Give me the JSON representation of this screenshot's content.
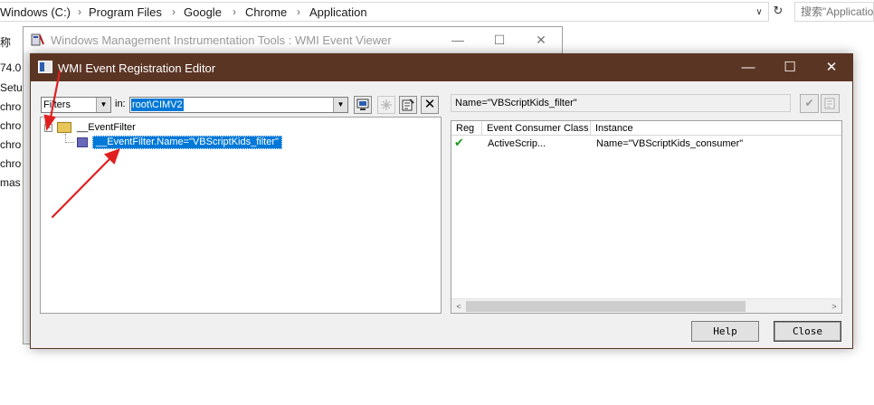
{
  "explorer": {
    "breadcrumbs": [
      "Windows (C:)",
      "Program Files",
      "Google",
      "Chrome",
      "Application"
    ],
    "search_placeholder": "搜索\"Application\"",
    "file_list": [
      "称",
      "74.0",
      "Setu",
      "chro",
      "chro",
      "chro",
      "chro",
      "mas"
    ]
  },
  "viewer": {
    "title": "Windows Management Instrumentation Tools : WMI Event Viewer"
  },
  "editor": {
    "title": "WMI Event Registration Editor",
    "filter_type": "Filters",
    "in_label": "in:",
    "namespace": "root\\CIMV2",
    "tree": {
      "root_label": "__EventFilter",
      "expander": "−",
      "child_label": "__EventFilter.Name=\"VBScriptKids_filter\""
    },
    "selected_path": "Name=\"VBScriptKids_filter\"",
    "grid": {
      "columns": [
        "Reg",
        "Event Consumer Class",
        "Instance"
      ],
      "rows": [
        {
          "consumer_class": "ActiveScrip...",
          "instance": "Name=\"VBScriptKids_consumer\""
        }
      ]
    },
    "buttons": {
      "help": "Help",
      "close": "Close"
    }
  },
  "colors": {
    "editor_titlebar": "#5b3524",
    "selection": "#0078d7",
    "annotation_arrow": "#e02020"
  }
}
